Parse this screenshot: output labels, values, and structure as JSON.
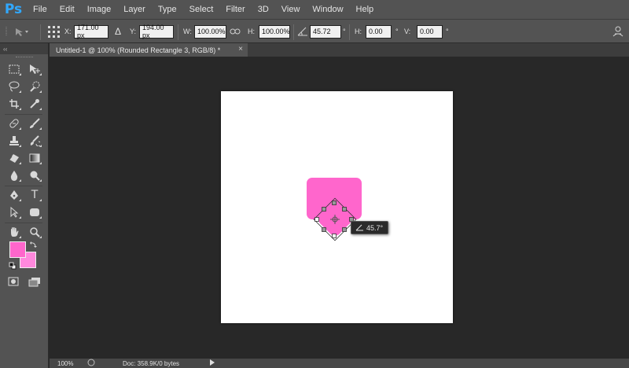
{
  "app": {
    "logo": "Ps"
  },
  "menu": [
    "File",
    "Edit",
    "Image",
    "Layer",
    "Type",
    "Select",
    "Filter",
    "3D",
    "View",
    "Window",
    "Help"
  ],
  "options": {
    "x_label": "X:",
    "x_value": "171.00 px",
    "y_label": "Y:",
    "y_value": "194.00 px",
    "w_label": "W:",
    "w_value": "100.00%",
    "h_label": "H:",
    "h_value": "100.00%",
    "angle_value": "45.72",
    "degree_symbol": "°",
    "hskew_label": "H:",
    "hskew_value": "0.00",
    "vskew_label": "V:",
    "vskew_value": "0.00"
  },
  "tab": {
    "title": "Untitled-1 @ 100% (Rounded Rectangle 3, RGB/8) *",
    "close": "×"
  },
  "tools_header": "‹‹",
  "canvas": {
    "rotation_readout": "45.7°"
  },
  "colors": {
    "foreground": "#ff66cc",
    "background": "#ff88dd",
    "shape": "#ff66cc"
  },
  "status": {
    "zoom": "100%",
    "doc": "Doc: 358.9K/0 bytes"
  }
}
